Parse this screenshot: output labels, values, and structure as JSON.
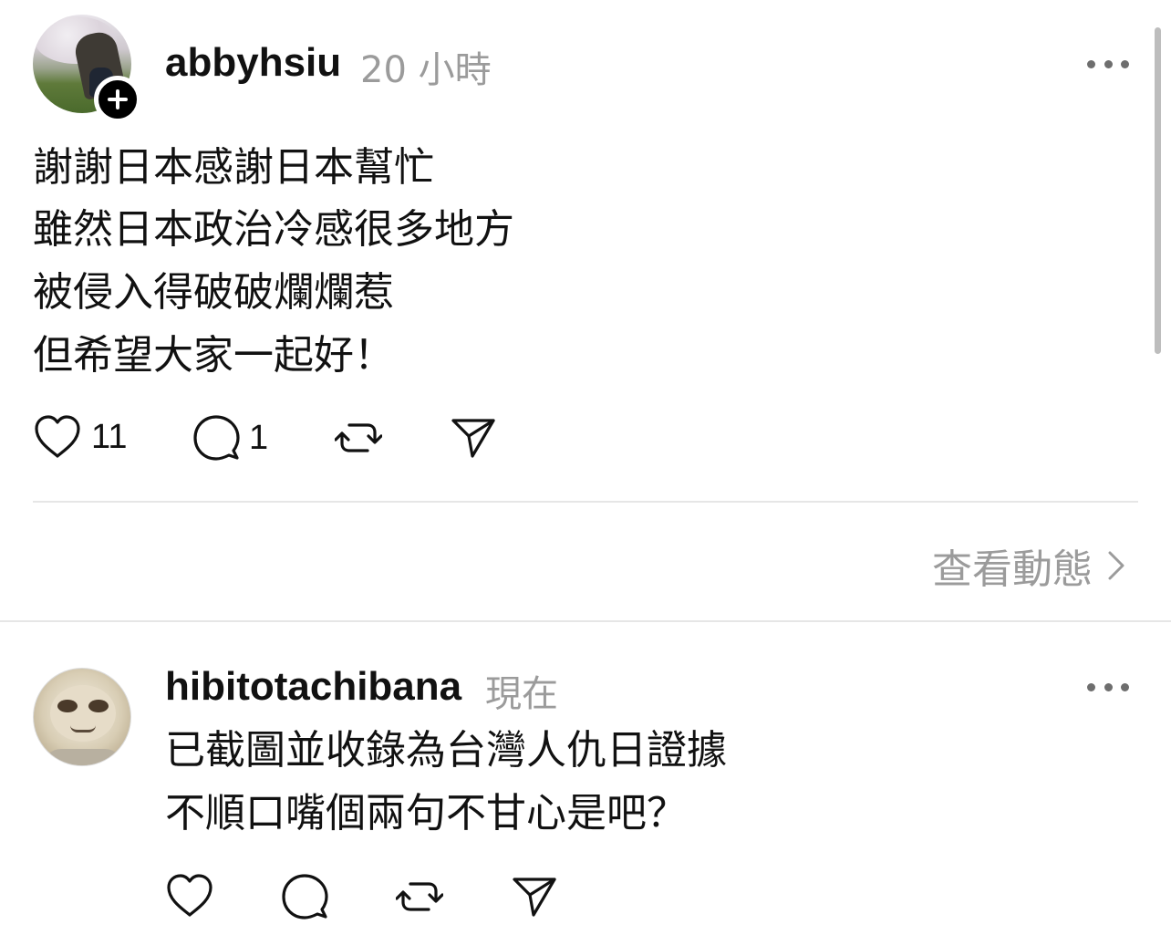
{
  "post": {
    "username": "abbyhsiu",
    "time": "20 小時",
    "lines": [
      "謝謝日本感謝日本幫忙",
      "雖然日本政治冷感很多地方",
      "被侵入得破破爛爛惹",
      "但希望大家一起好！"
    ],
    "likes": "11",
    "comments": "1",
    "icons": {
      "like": "heart-icon",
      "comment": "comment-bubble-icon",
      "repost": "repost-icon",
      "share": "send-icon",
      "more": "more-dots-icon",
      "follow": "plus-icon"
    }
  },
  "activity": {
    "label": "查看動態"
  },
  "reply": {
    "username": "hibitotachibana",
    "time": "現在",
    "lines": [
      "已截圖並收錄為台灣人仇日證據",
      "不順口嘴個兩句不甘心是吧？"
    ]
  },
  "colors": {
    "text": "#111111",
    "muted": "#9b9b9b",
    "divider": "#e6e6e6",
    "background": "#ffffff"
  }
}
